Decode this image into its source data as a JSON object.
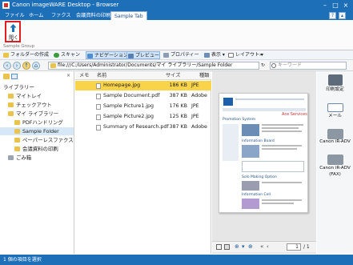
{
  "window": {
    "title": "Canon imageWARE Desktop - Browser"
  },
  "ribbon_tabs": [
    "ファイル",
    "ホーム",
    "ファクス",
    "会議資料の印刷",
    "Sample Tab"
  ],
  "ribbon": {
    "open_label": "開く",
    "open_dropdown": "▾",
    "group_label": "Sample Group"
  },
  "toolbar": {
    "new_folder": "フォルダーの作成",
    "scan": "スキャン",
    "navigation": "ナビゲーション",
    "preview": "プレビュー",
    "properties": "プロパティー",
    "view": "表示",
    "layout": "レイアウト",
    "more": "»"
  },
  "address": {
    "path": "file:///C:/Users/Administrator/Documents/マイ ライブラリー/Sample Folder",
    "search_placeholder": "キーワード"
  },
  "library": {
    "title": "ライブラリー",
    "items": [
      {
        "label": "マイトレイ",
        "indent": 1
      },
      {
        "label": "チェックアウト",
        "indent": 1
      },
      {
        "label": "マイ ライブラリー",
        "indent": 1
      },
      {
        "label": "PDFハンドリング",
        "indent": 2
      },
      {
        "label": "Sample Folder",
        "indent": 2
      },
      {
        "label": "ペーパーレスファクス",
        "indent": 2
      },
      {
        "label": "会議資料の印刷",
        "indent": 2
      },
      {
        "label": "ごみ箱",
        "indent": 1
      }
    ]
  },
  "files": {
    "headers": {
      "memo": "メモ",
      "name": "名前",
      "size": "サイズ",
      "desc": "種類"
    },
    "rows": [
      {
        "name": "Homepage.jpg",
        "size": "186 KB",
        "desc": "JPE"
      },
      {
        "name": "Sample Document.pdf",
        "size": "387 KB",
        "desc": "Adobe"
      },
      {
        "name": "Sample Picture1.jpg",
        "size": "176 KB",
        "desc": "JPE"
      },
      {
        "name": "Sample Picture2.jpg",
        "size": "125 KB",
        "desc": "JPE"
      },
      {
        "name": "Summary of Research.pdf",
        "size": "387 KB",
        "desc": "Adobe"
      }
    ]
  },
  "preview": {
    "page_label": "Ace Services",
    "section1": "Promotion System",
    "section2": "Information Board",
    "section3": "Solo Making Option",
    "section4": "Information Cell",
    "page_current": "1",
    "page_total": "/ 1"
  },
  "apps": [
    {
      "label": "印刷設定"
    },
    {
      "label": "メール"
    },
    {
      "label": "Canon iR-ADV"
    },
    {
      "label": "Canon iR-ADV (FAX)"
    }
  ],
  "status": {
    "text": "1 個の項目を選択"
  }
}
